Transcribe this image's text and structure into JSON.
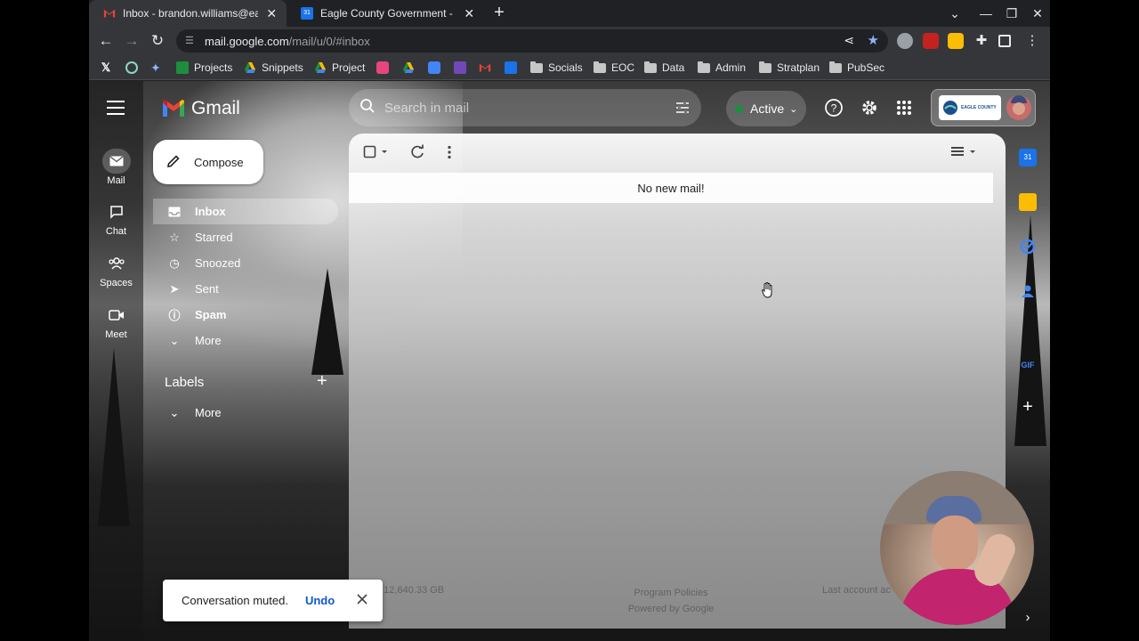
{
  "browser": {
    "tabs": [
      {
        "title": "Inbox - brandon.williams@eagle",
        "active": true
      },
      {
        "title": "Eagle County Government - Cale",
        "active": false
      }
    ],
    "omnibox": {
      "host": "mail.google.com",
      "path": "/mail/u/0/#inbox"
    },
    "bookmarks": [
      {
        "label": "",
        "icon": "x-icon"
      },
      {
        "label": "",
        "icon": "chatgpt-icon"
      },
      {
        "label": "",
        "icon": "gemini-icon"
      },
      {
        "label": "Projects",
        "icon": "sheets-icon"
      },
      {
        "label": "Snippets",
        "icon": "drive-icon"
      },
      {
        "label": "Project",
        "icon": "drive-icon"
      },
      {
        "label": "Socials",
        "icon": "folder-icon"
      },
      {
        "label": "EOC",
        "icon": "folder-icon"
      },
      {
        "label": "Data",
        "icon": "folder-icon"
      },
      {
        "label": "Admin",
        "icon": "folder-icon"
      },
      {
        "label": "Stratplan",
        "icon": "folder-icon"
      },
      {
        "label": "PubSec",
        "icon": "folder-icon"
      }
    ]
  },
  "gmail": {
    "app_name": "Gmail",
    "rail": [
      {
        "label": "Mail",
        "icon": "mail-icon",
        "selected": true
      },
      {
        "label": "Chat",
        "icon": "chat-icon",
        "selected": false
      },
      {
        "label": "Spaces",
        "icon": "spaces-icon",
        "selected": false
      },
      {
        "label": "Meet",
        "icon": "meet-icon",
        "selected": false
      }
    ],
    "compose_label": "Compose",
    "nav": [
      {
        "label": "Inbox",
        "icon": "inbox-icon"
      },
      {
        "label": "Starred",
        "icon": "star-icon"
      },
      {
        "label": "Snoozed",
        "icon": "clock-icon"
      },
      {
        "label": "Sent",
        "icon": "send-icon"
      },
      {
        "label": "Spam",
        "icon": "spam-icon"
      },
      {
        "label": "More",
        "icon": "chevron-down-icon"
      }
    ],
    "labels_heading": "Labels",
    "labels_more": "More",
    "search_placeholder": "Search in mail",
    "status_label": "Active",
    "org_name": "EAGLE COUNTY",
    "empty_message": "No new mail!",
    "footer": {
      "storage": "g 12,640.33 GB",
      "policies": "Program Policies",
      "powered": "Powered by Google",
      "activity": "Last account ac"
    },
    "toast": {
      "message": "Conversation muted.",
      "action": "Undo"
    }
  },
  "colors": {
    "accent": "#0b57d0",
    "active_status": "#1e8e3e"
  }
}
